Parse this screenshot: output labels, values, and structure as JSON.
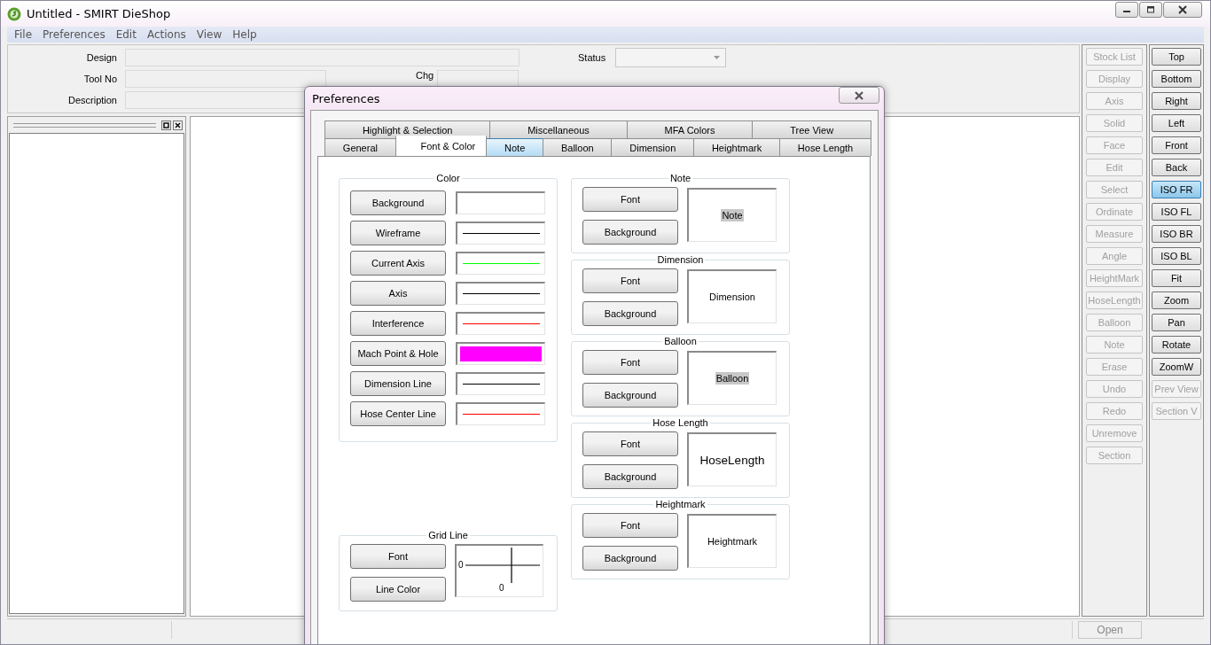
{
  "window": {
    "title": "Untitled - SMIRT DieShop"
  },
  "menu": [
    "File",
    "Preferences",
    "Edit",
    "Actions",
    "View",
    "Help"
  ],
  "form": {
    "design_label": "Design",
    "tool_no_label": "Tool No",
    "chg_label": "Chg",
    "description_label": "Description",
    "status_label": "Status"
  },
  "edit_toolbar": [
    {
      "label": "Stock List",
      "disabled": true
    },
    {
      "label": "Display",
      "disabled": true
    },
    {
      "label": "Axis",
      "disabled": true
    },
    {
      "label": "Solid",
      "disabled": true
    },
    {
      "label": "Face",
      "disabled": true
    },
    {
      "label": "Edit",
      "disabled": true
    },
    {
      "label": "Select",
      "disabled": true
    },
    {
      "label": "Ordinate",
      "disabled": true
    },
    {
      "label": "Measure",
      "disabled": true
    },
    {
      "label": "Angle",
      "disabled": true
    },
    {
      "label": "HeightMark",
      "disabled": true
    },
    {
      "label": "HoseLength",
      "disabled": true
    },
    {
      "label": "Balloon",
      "disabled": true
    },
    {
      "label": "Note",
      "disabled": true
    },
    {
      "label": "Erase",
      "disabled": true
    },
    {
      "label": "Undo",
      "disabled": true
    },
    {
      "label": "Redo",
      "disabled": true
    },
    {
      "label": "Unremove",
      "disabled": true
    },
    {
      "label": "Section",
      "disabled": true
    }
  ],
  "view_toolbar": [
    {
      "label": "Top",
      "disabled": false,
      "selected": false
    },
    {
      "label": "Bottom",
      "disabled": false,
      "selected": false
    },
    {
      "label": "Right",
      "disabled": false,
      "selected": false
    },
    {
      "label": "Left",
      "disabled": false,
      "selected": false
    },
    {
      "label": "Front",
      "disabled": false,
      "selected": false
    },
    {
      "label": "Back",
      "disabled": false,
      "selected": false
    },
    {
      "label": "ISO FR",
      "disabled": false,
      "selected": true
    },
    {
      "label": "ISO FL",
      "disabled": false,
      "selected": false
    },
    {
      "label": "ISO BR",
      "disabled": false,
      "selected": false
    },
    {
      "label": "ISO BL",
      "disabled": false,
      "selected": false
    },
    {
      "label": "Fit",
      "disabled": false,
      "selected": false
    },
    {
      "label": "Zoom",
      "disabled": false,
      "selected": false
    },
    {
      "label": "Pan",
      "disabled": false,
      "selected": false
    },
    {
      "label": "Rotate",
      "disabled": false,
      "selected": false
    },
    {
      "label": "ZoomW",
      "disabled": false,
      "selected": false
    },
    {
      "label": "Prev View",
      "disabled": true,
      "selected": false
    },
    {
      "label": "Section V",
      "disabled": true,
      "selected": false
    }
  ],
  "status_bar": {
    "open_button": {
      "label": "Open",
      "disabled": true
    }
  },
  "dialog": {
    "title": "Preferences",
    "tab_rows": [
      [
        {
          "label": "Highlight & Selection",
          "selected": false,
          "hovered": false
        },
        {
          "label": "Miscellaneous",
          "selected": false,
          "hovered": false
        },
        {
          "label": "MFA Colors",
          "selected": false,
          "hovered": false
        },
        {
          "label": "Tree View",
          "selected": false,
          "hovered": false
        }
      ],
      [
        {
          "label": "General",
          "selected": false,
          "hovered": false
        },
        {
          "label": "Font & Color",
          "selected": true,
          "hovered": false
        },
        {
          "label": "Note",
          "selected": false,
          "hovered": true
        },
        {
          "label": "Balloon",
          "selected": false,
          "hovered": false
        },
        {
          "label": "Dimension",
          "selected": false,
          "hovered": false
        },
        {
          "label": "Heightmark",
          "selected": false,
          "hovered": false
        },
        {
          "label": "Hose Length",
          "selected": false,
          "hovered": false
        }
      ]
    ],
    "color_group": {
      "title": "Color",
      "rows": [
        {
          "label": "Background",
          "swatch": {
            "kind": "fill",
            "color": "#ffffff"
          }
        },
        {
          "label": "Wireframe",
          "swatch": {
            "kind": "line",
            "color": "#000000"
          }
        },
        {
          "label": "Current Axis",
          "swatch": {
            "kind": "line",
            "color": "#00ff00"
          }
        },
        {
          "label": "Axis",
          "swatch": {
            "kind": "line",
            "color": "#000000"
          }
        },
        {
          "label": "Interference",
          "swatch": {
            "kind": "line",
            "color": "#ff0000"
          }
        },
        {
          "label": "Mach Point & Hole",
          "swatch": {
            "kind": "fill",
            "color": "#ff00ff"
          }
        },
        {
          "label": "Dimension Line",
          "swatch": {
            "kind": "line",
            "color": "#000000"
          }
        },
        {
          "label": "Hose Center Line",
          "swatch": {
            "kind": "line",
            "color": "#ff0000"
          }
        }
      ]
    },
    "grid_group": {
      "title": "Grid Line",
      "buttons": [
        "Font",
        "Line Color"
      ],
      "axis_labels": [
        "0",
        "0"
      ]
    },
    "sample_groups": [
      {
        "title": "Note",
        "buttons": [
          "Font",
          "Background"
        ],
        "sample": "Note",
        "sample_highlighted": true,
        "sample_large": false
      },
      {
        "title": "Dimension",
        "buttons": [
          "Font",
          "Background"
        ],
        "sample": "Dimension",
        "sample_highlighted": false,
        "sample_large": false
      },
      {
        "title": "Balloon",
        "buttons": [
          "Font",
          "Background"
        ],
        "sample": "Balloon",
        "sample_highlighted": true,
        "sample_large": false
      },
      {
        "title": "Hose Length",
        "buttons": [
          "Font",
          "Background"
        ],
        "sample": "HoseLength",
        "sample_highlighted": false,
        "sample_large": true
      },
      {
        "title": "Heightmark",
        "buttons": [
          "Font",
          "Background"
        ],
        "sample": "Heightmark",
        "sample_highlighted": false,
        "sample_large": false
      }
    ]
  }
}
